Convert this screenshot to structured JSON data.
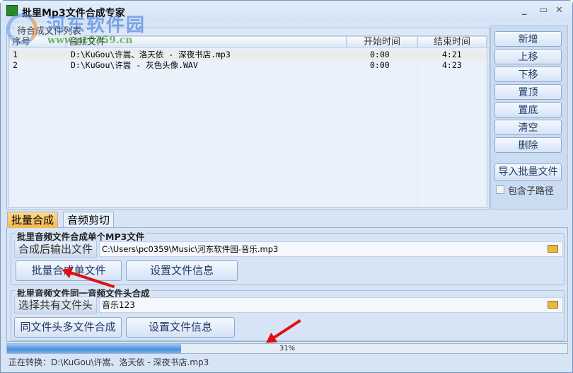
{
  "window": {
    "title": "批里Mp3文件合成专家",
    "minimize": "_",
    "maximize": "▭",
    "close": "✕"
  },
  "watermark": {
    "name": "河东软件园",
    "url": "www.pc0359.cn"
  },
  "list": {
    "group_title": "待合成文件列表",
    "columns": [
      "序号",
      "音频文件",
      "开始时间",
      "结束时间"
    ],
    "rows": [
      {
        "no": "1",
        "file": "D:\\KuGou\\许嵩、洛天依 - 深夜书店.mp3",
        "start": "0:00",
        "end": "4:21"
      },
      {
        "no": "2",
        "file": "D:\\KuGou\\许嵩 - 灰色头像.WAV",
        "start": "0:00",
        "end": "4:23"
      }
    ]
  },
  "side": {
    "buttons": [
      "新增",
      "上移",
      "下移",
      "置顶",
      "置底",
      "清空",
      "删除"
    ],
    "import": "导入批量文件",
    "include_sub": "包含子路径",
    "include_sub_checked": false
  },
  "tabs": [
    "批量合成",
    "音频剪切"
  ],
  "group1": {
    "title": "批里音频文件合成单个MP3文件",
    "label": "合成后输出文件",
    "value": "C:\\Users\\pc0359\\Music\\河东软件园-音乐.mp3",
    "btn1": "批量合成单文件",
    "btn2": "设置文件信息"
  },
  "group2": {
    "title": "批里音频文件同一音频文件头合成",
    "label": "选择共有文件头",
    "value": "音乐123",
    "btn1": "同文件头多文件合成",
    "btn2": "设置文件信息"
  },
  "progress": {
    "percent": 31,
    "label": "31%"
  },
  "status": "正在转换：D:\\KuGou\\许嵩、洛天依 - 深夜书店.mp3"
}
